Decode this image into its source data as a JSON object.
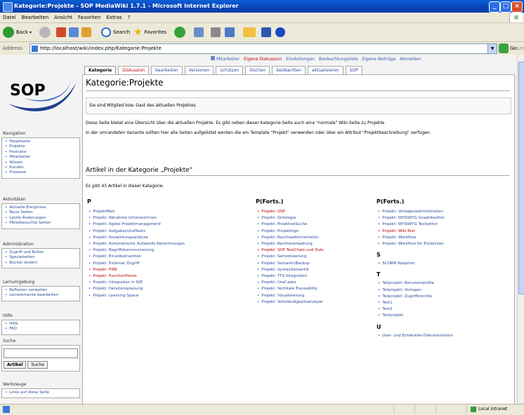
{
  "window": {
    "title": "Kategorie:Projekte - SOP MediaWiki 1.7.1 - Microsoft Internet Explorer"
  },
  "menu": [
    "Datei",
    "Bearbeiten",
    "Ansicht",
    "Favoriten",
    "Extras",
    "?"
  ],
  "toolbar": {
    "back": "Back",
    "search": "Search",
    "favorites": "Favorites"
  },
  "address": {
    "label": "Address",
    "url": "http://localhost/wiki/index.php/Kategorie:Projekte",
    "go": "Go",
    "links": "Links"
  },
  "personal": [
    "Mitarbeiter",
    "Eigene Diskussion",
    "Einstellungen",
    "Beobachtungsliste",
    "Eigene Beiträge",
    "Abmelden"
  ],
  "logo": {
    "text": "SOP"
  },
  "tabs": [
    "Kategorie",
    "Diskussion",
    "bearbeiten",
    "Versionen",
    "schützen",
    "löschen",
    "beobachten",
    "aktualisieren",
    "SOP"
  ],
  "page": {
    "title": "Kategorie:Projekte",
    "notice": "Sie sind Mitglied bzw. Gast des aktuellen Projektes",
    "para1": "Diese Seite bietet eine Übersicht über die aktuellen Projekte. Es gibt neben dieser Kategorie-Seite auch eine \"normale\" Wiki-Seite zu Projekte",
    "para2": "In der umrandeten Variante sollten hier alle Seiten aufgelistet werden die ein Template \"Projekt\" verwenden oder über ein Attribut \"Projektbeschreibung\" verfügen.",
    "subheading": "Artikel in der Kategorie „Projekte“",
    "count": "Es gibt 43 Artikel in dieser Kategorie.",
    "col1": {
      "head": "P",
      "items": [
        "ProjektMed",
        "Projekt: Abnahme Unterzeichnen",
        "Projekt: Agiles Projektmanagement",
        "Projekt: AufgabenUndTasks",
        "Projekt: Auswirkungsanalyse",
        "Projekt: Automatische Aufwands-Berechnungen",
        "Projekt: Begriffsharmonisierung",
        "Projekt: Einzelbetrachten",
        "Projekt: Externer Zugriff",
        "Projekt: FIRE",
        "Projekt: FunctionPoints",
        "Projekt: Integration in IDE",
        "Projekt: Iterationsplanung",
        "Projekt: Learning Space"
      ]
    },
    "col2": {
      "head": "P(Forts.)",
      "items": [
        "Projekt: OSP",
        "Projekt: Ontologie",
        "Projekt: ProaktiveSuche",
        "Projekt: Projektlogs",
        "Projekt: Rechteadministration",
        "Projekt: Rechteverwaltung",
        "Projekt: SOP TestChain und Dots",
        "Projekt: Semiotisierung",
        "Projekt: SemanticBackup",
        "Projekt: SyntaxSemantik",
        "Projekt: TTS Integration",
        "Projekt: UseCases",
        "Projekt: Vertikale Traceability",
        "Projekt: Visualisierung",
        "Projekt: Vollständigkeitsanalyse"
      ]
    },
    "col3": {
      "head": "P(Forts.)",
      "items": [
        "Projekt: Vorlagenadministration",
        "Projekt: WYSIWYG Graphikeditor",
        "Projekt: WYSIWYG Texteditor",
        "Projekt: Wiki-Test",
        "Projekt: Workflow",
        "Projekt: Workflow für Entwickler"
      ],
      "s_head": "S",
      "s_items": [
        "SCORM Adaption"
      ],
      "t_head": "T",
      "t_items": [
        "Teilprojekt: Benutzerprofile",
        "Teilprojekt: Vorlagen",
        "Teilprojekt: Zugriffsrechte",
        "Test1",
        "Test2",
        "Testprojekt"
      ],
      "u_head": "U",
      "u_items": [
        "User- und Entwickler-Dokumentation"
      ]
    }
  },
  "sidebar": {
    "navigation": {
      "label": "Navigation",
      "items": [
        "Hauptseite",
        "Projekte",
        "Produkte",
        "Mitarbeiter",
        "Wissen",
        "Kunden",
        "Prozesse"
      ]
    },
    "aktivitaeten": {
      "label": "Aktivitäten",
      "items": [
        "Aktuelle Ereignisse",
        "Neue Seiten",
        "Letzte Änderungen",
        "Meistbesuchte Seiten"
      ]
    },
    "administration": {
      "label": "Administration",
      "items": [
        "Zugriff und Rollen",
        "Spezialseiten",
        "Bücher ändern"
      ]
    },
    "lernumgebung": {
      "label": "Lernumgebung",
      "items": [
        "Reflexion verwalten",
        "Lernelemente bearbeiten"
      ]
    },
    "hilfe": {
      "label": "Hilfe",
      "items": [
        "Hilfe",
        "FAQ"
      ]
    },
    "suche": {
      "label": "Suche",
      "article_btn": "Artikel",
      "search_btn": "Suche"
    },
    "werkzeuge": {
      "label": "Werkzeuge",
      "items": [
        "Links auf diese Seite"
      ]
    }
  },
  "status": {
    "zone": "Local intranet"
  },
  "colors": {
    "link": "#2a4b9a",
    "newlink": "#ba0000",
    "xp_blue": "#0845b8"
  }
}
